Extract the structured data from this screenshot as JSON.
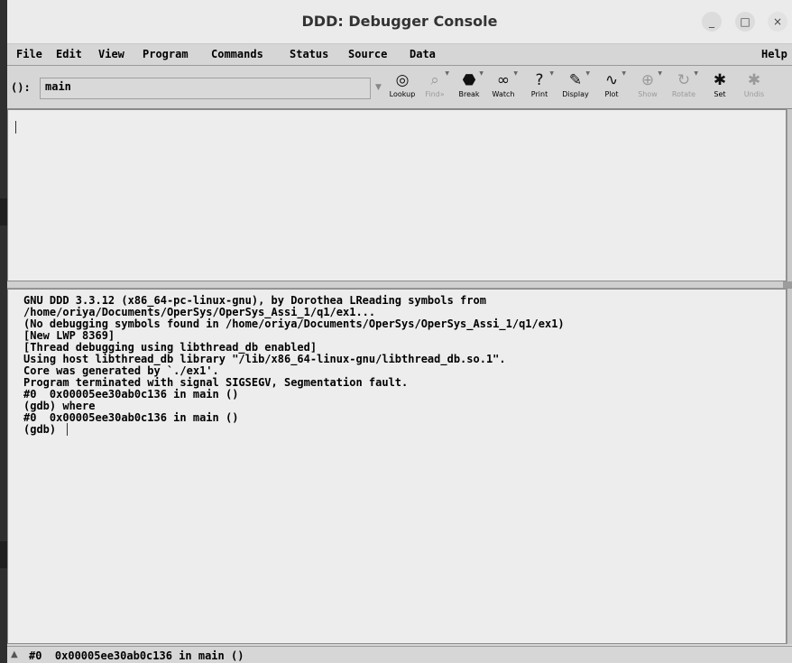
{
  "window": {
    "title": "DDD: Debugger Console",
    "min_glyph": "_",
    "max_glyph": "□",
    "close_glyph": "×"
  },
  "menubar": {
    "file": "File",
    "edit": "Edit",
    "view": "View",
    "program": "Program",
    "commands": "Commands",
    "status": "Status",
    "source": "Source",
    "data": "Data",
    "help": "Help"
  },
  "toolbar": {
    "arg_label": "():",
    "arg_value": "main",
    "tools": [
      {
        "label": "Lookup",
        "icon": "lookup-icon",
        "enabled": true
      },
      {
        "label": "Find»",
        "icon": "find-icon",
        "enabled": false
      },
      {
        "label": "Break",
        "icon": "stop-sign-icon",
        "enabled": true
      },
      {
        "label": "Watch",
        "icon": "watch-glasses-icon",
        "enabled": true
      },
      {
        "label": "Print",
        "icon": "print-question-icon",
        "enabled": true
      },
      {
        "label": "Display",
        "icon": "display-icon",
        "enabled": true
      },
      {
        "label": "Plot",
        "icon": "plot-icon",
        "enabled": true
      },
      {
        "label": "Show",
        "icon": "show-magnifier-icon",
        "enabled": false
      },
      {
        "label": "Rotate",
        "icon": "rotate-icon",
        "enabled": false
      },
      {
        "label": "Set",
        "icon": "set-icon",
        "enabled": true
      },
      {
        "label": "Undis",
        "icon": "undisplay-icon",
        "enabled": false
      }
    ]
  },
  "console": {
    "lines": [
      "GNU DDD 3.3.12 (x86_64-pc-linux-gnu), by Dorothea LReading symbols from",
      "/home/oriya/Documents/OperSys/OperSys_Assi_1/q1/ex1...",
      "(No debugging symbols found in /home/oriya/Documents/OperSys/OperSys_Assi_1/q1/ex1)",
      "[New LWP 8369]",
      "[Thread debugging using libthread_db enabled]",
      "Using host libthread_db library \"/lib/x86_64-linux-gnu/libthread_db.so.1\".",
      "Core was generated by `./ex1'.",
      "Program terminated with signal SIGSEGV, Segmentation fault.",
      "#0  0x00005ee30ab0c136 in main ()",
      "(gdb) where",
      "#0  0x00005ee30ab0c136 in main ()",
      "(gdb) "
    ]
  },
  "statusbar": {
    "text": "#0  0x00005ee30ab0c136 in main ()"
  }
}
